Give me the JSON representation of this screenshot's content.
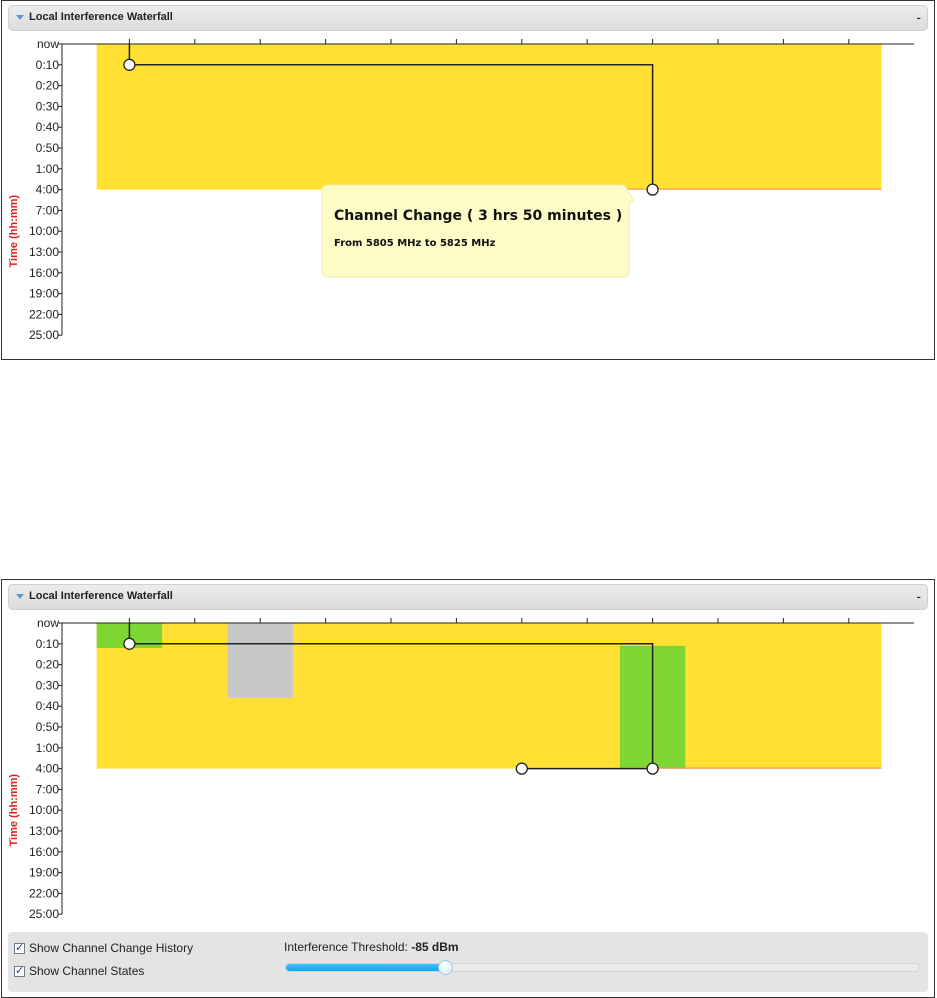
{
  "colors": {
    "interference_high": "#ffe033",
    "interference_low": "#7ed632",
    "unavailable": "#c8c8c8",
    "line": "#222222",
    "axis_title": "#e02020",
    "tooltip_bg": "#fffdc7",
    "threshold_fill": "#1fb3f5"
  },
  "top_panel": {
    "title": "Local Interference Waterfall",
    "collapse": "-",
    "tooltip": {
      "title": "Channel Change ( 3 hrs 50 minutes )",
      "detail": "From 5805 MHz to 5825 MHz"
    }
  },
  "bottom_panel": {
    "title": "Local Interference Waterfall",
    "collapse": "-",
    "show_history": {
      "label": "Show Channel Change History",
      "checked": true
    },
    "show_states": {
      "label": "Show Channel States",
      "checked": true
    },
    "threshold": {
      "label": "Interference Threshold:",
      "value": "-85 dBm",
      "fraction": 0.25
    }
  },
  "chart_data": [
    {
      "type": "heatmap",
      "title": "Local Interference Waterfall",
      "ylabel": "Time (hh:mm)",
      "xlabel": "",
      "y_ticks": [
        "now",
        "0:10",
        "0:20",
        "0:30",
        "0:40",
        "0:50",
        "1:00",
        "4:00",
        "7:00",
        "10:00",
        "13:00",
        "16:00",
        "19:00",
        "22:00",
        "25:00"
      ],
      "x_tick_count": 13,
      "channels": 13,
      "cells": [
        {
          "state": "high",
          "col_start": 0.5,
          "col_end": 12.5,
          "t_start": 0,
          "t_end": 7
        }
      ],
      "markers": [
        {
          "t": 1,
          "col": 1
        },
        {
          "t": 7,
          "col": 9
        }
      ],
      "channel_path": [
        [
          1,
          0
        ],
        [
          1,
          1
        ],
        [
          9,
          1
        ],
        [
          9,
          7
        ]
      ]
    },
    {
      "type": "heatmap",
      "title": "Local Interference Waterfall",
      "ylabel": "Time (hh:mm)",
      "xlabel": "",
      "y_ticks": [
        "now",
        "0:10",
        "0:20",
        "0:30",
        "0:40",
        "0:50",
        "1:00",
        "4:00",
        "7:00",
        "10:00",
        "13:00",
        "16:00",
        "19:00",
        "22:00",
        "25:00"
      ],
      "x_tick_count": 13,
      "channels": 13,
      "cells": [
        {
          "state": "high",
          "col_start": 0.5,
          "col_end": 12.5,
          "t_start": 0,
          "t_end": 7
        },
        {
          "state": "low",
          "col_start": 0.5,
          "col_end": 1.5,
          "t_start": 0,
          "t_end": 1.2
        },
        {
          "state": "unavailable",
          "col_start": 2.5,
          "col_end": 3.5,
          "t_start": 0,
          "t_end": 3.6
        },
        {
          "state": "low",
          "col_start": 8.5,
          "col_end": 9.5,
          "t_start": 1.1,
          "t_end": 7
        }
      ],
      "markers": [
        {
          "t": 1,
          "col": 1
        },
        {
          "t": 7,
          "col": 7
        },
        {
          "t": 7,
          "col": 9
        }
      ],
      "channel_path": [
        [
          1,
          0
        ],
        [
          1,
          1
        ],
        [
          9,
          1
        ],
        [
          9,
          7
        ],
        [
          7,
          7
        ]
      ]
    }
  ]
}
